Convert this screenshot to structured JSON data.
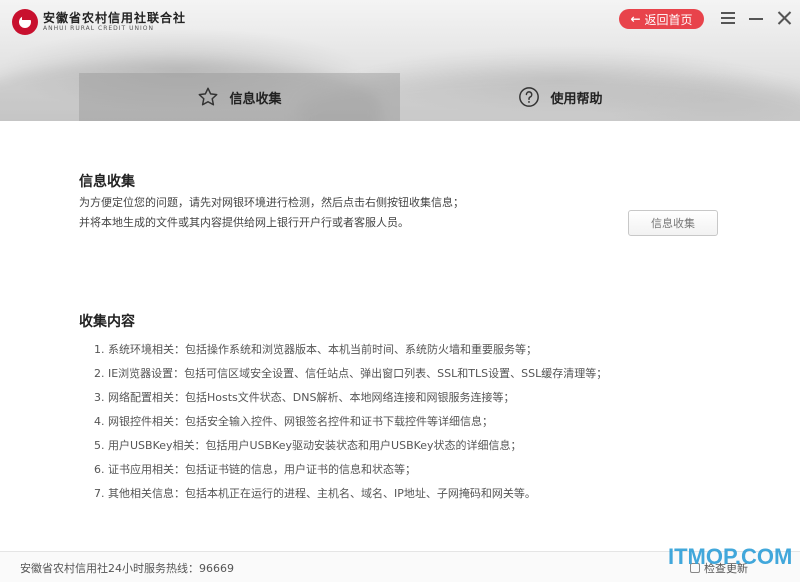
{
  "brand": {
    "name_cn": "安徽省农村信用社联合社",
    "name_en": "ANHUI RURAL CREDIT UNION",
    "color": "#c8102e"
  },
  "window": {
    "home_label": "返回首页",
    "home_icon": "arrow-left-icon",
    "menu_icon": "menu-icon",
    "minimize_icon": "minimize-icon",
    "close_icon": "close-icon",
    "accent": "#e8434b"
  },
  "tabs": [
    {
      "label": "信息收集",
      "icon": "star-icon",
      "active": true
    },
    {
      "label": "使用帮助",
      "icon": "help-circle-icon",
      "active": false
    }
  ],
  "info_section": {
    "title": "信息收集",
    "desc_line1": "为方便定位您的问题，请先对网银环境进行检测，然后点击右侧按钮收集信息；",
    "desc_line2": "并将本地生成的文件或其内容提供给网上银行开户行或者客服人员。",
    "button_label": "信息收集"
  },
  "content_section": {
    "title": "收集内容",
    "items": [
      "1. 系统环境相关：包括操作系统和浏览器版本、本机当前时间、系统防火墙和重要服务等；",
      "2. IE浏览器设置：包括可信区域安全设置、信任站点、弹出窗口列表、SSL和TLS设置、SSL缓存清理等；",
      "3. 网络配置相关：包括Hosts文件状态、DNS解析、本地网络连接和网银服务连接等；",
      "4. 网银控件相关：包括安全输入控件、网银签名控件和证书下载控件等详细信息；",
      "5. 用户USBKey相关：包括用户USBKey驱动安装状态和用户USBKey状态的详细信息；",
      "6. 证书应用相关：包括证书链的信息，用户证书的信息和状态等；",
      "7. 其他相关信息：包括本机正在运行的进程、主机名、域名、IP地址、子网掩码和网关等。"
    ]
  },
  "footer": {
    "hotline": "安徽省农村信用社24小时服务热线：96669",
    "update_label": "检查更新"
  },
  "watermark": {
    "text": "ITMOP.COM",
    "color": "#2e9fd8"
  }
}
